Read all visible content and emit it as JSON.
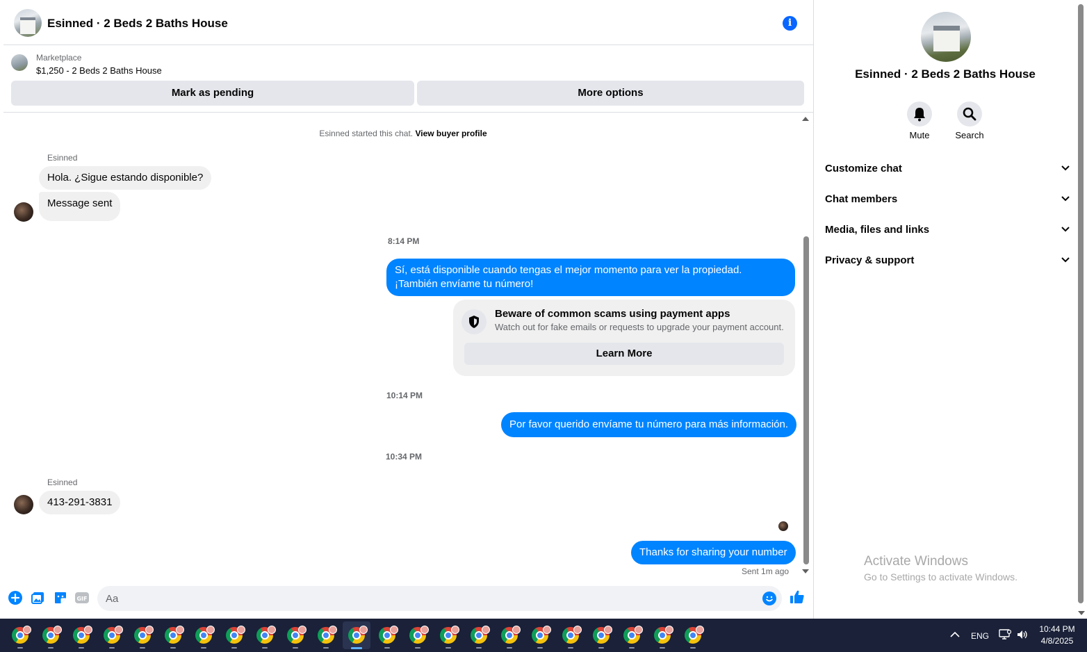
{
  "chat": {
    "title": "Esinned · 2 Beds 2 Baths House",
    "listing": {
      "kind": "Marketplace",
      "title": "$1,250 - 2 Beds 2 Baths House",
      "pending_button": "Mark as pending",
      "more_button": "More options"
    },
    "started_prefix": "Esinned started this chat.",
    "view_profile": "View buyer profile",
    "messages": [
      {
        "sender": "Esinned",
        "text": "Hola. ¿Sigue estando disponible?"
      },
      {
        "text": "Message sent"
      },
      {
        "time": "8:14 PM"
      },
      {
        "text": "Sí, está disponible cuando tengas el mejor momento para ver la propiedad. ¡También envíame tu número!"
      },
      {
        "time": "10:14 PM"
      },
      {
        "text": "Por favor querido envíame tu número para más información."
      },
      {
        "time": "10:34 PM"
      },
      {
        "sender": "Esinned",
        "text": "413-291-3831"
      },
      {
        "text": "Thanks for sharing your number"
      }
    ],
    "scam_card": {
      "title": "Beware of common scams using payment apps",
      "body": "Watch out for fake emails or requests to upgrade your payment account.",
      "button": "Learn More"
    },
    "sent_status": "Sent 1m ago",
    "composer_placeholder": "Aa",
    "accent_color": "#0084ff"
  },
  "details": {
    "title": "Esinned · 2 Beds 2 Baths House",
    "actions": [
      {
        "label": "Mute",
        "icon": "bell-icon"
      },
      {
        "label": "Search",
        "icon": "search-icon"
      }
    ],
    "sections": [
      "Customize chat",
      "Chat members",
      "Media, files and links",
      "Privacy & support"
    ]
  },
  "watermark": {
    "title": "Activate Windows",
    "subtitle": "Go to Settings to activate Windows."
  },
  "taskbar": {
    "app_icon": "chrome-icon",
    "app_count": 23,
    "active_index": 11,
    "language": "ENG",
    "time": "10:44 PM",
    "date": "4/8/2025"
  }
}
